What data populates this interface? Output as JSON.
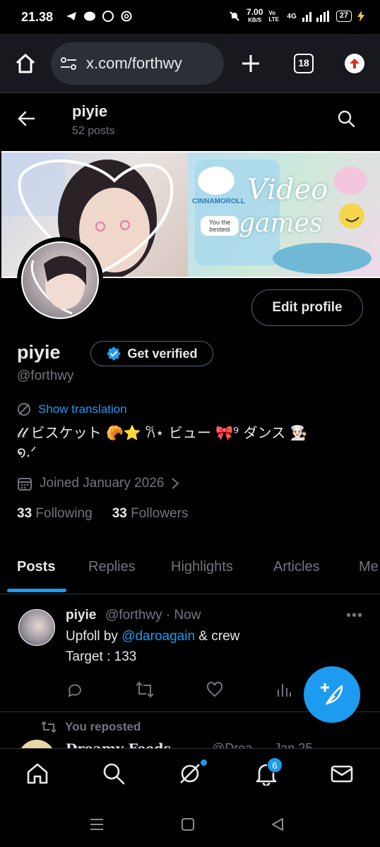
{
  "status_bar": {
    "time": "21.38",
    "net_speed": "7.00",
    "net_unit": "KB/S",
    "volte": "Vo LTE",
    "network": "4G",
    "battery": "27"
  },
  "browser": {
    "url": "x.com/forthwy",
    "tab_count": "18"
  },
  "profile_header": {
    "name": "piyie",
    "post_count": "52 posts"
  },
  "banner": {
    "text_video": "Video",
    "text_games": "games",
    "sticker": "You the bestest",
    "brand": "CINNAMOROLL"
  },
  "profile": {
    "edit_label": "Edit profile",
    "display_name": "piyie",
    "get_verified_label": "Get verified",
    "handle": "@forthwy",
    "show_translation": "Show translation",
    "bio_line1": "𝓁𝓁 ビスケット 🥐⭐ 𐙚⋆ ビュー 🎀⁹ ダンス 👨🏻‍🍳",
    "bio_line2": "໑.ᐟ",
    "joined": "Joined January 2026",
    "following_count": "33",
    "following_label": "Following",
    "followers_count": "33",
    "followers_label": "Followers"
  },
  "tabs": [
    "Posts",
    "Replies",
    "Highlights",
    "Articles",
    "Me"
  ],
  "post": {
    "author": "piyie",
    "meta": "@forthwy · Now",
    "text_prefix": "Upfoll by ",
    "mention": "@daroagain",
    "text_suffix": " & crew",
    "line2": "Target : 133"
  },
  "reposted": {
    "label": "You reposted",
    "peek_name": "Dreamy Feeds",
    "peek_meta": "@Drea... · Jan 25"
  },
  "bottom_nav": {
    "notifications_badge": "6"
  },
  "colors": {
    "accent": "#1d9bf0",
    "background": "#000000",
    "muted_text": "#71767b",
    "text": "#e7e9ea"
  }
}
